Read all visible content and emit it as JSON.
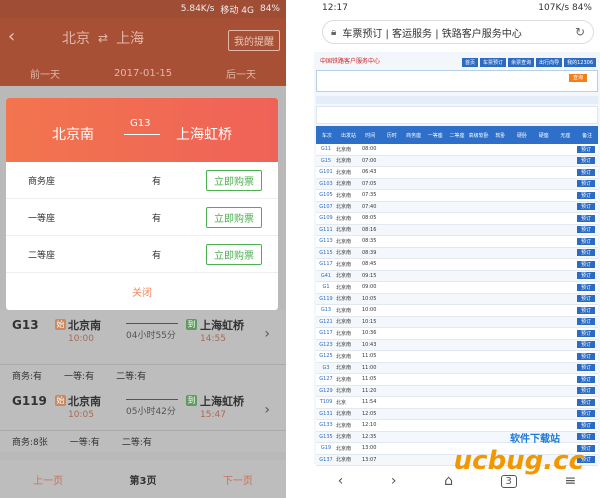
{
  "left": {
    "status": {
      "speed": "5.84K/s",
      "carrier": "移动 4G",
      "battery": "84%"
    },
    "header": {
      "from": "北京",
      "to": "上海",
      "help": "我的提醒"
    },
    "dates": {
      "prev": "前一天",
      "current": "2017-01-15",
      "next": "后一天"
    },
    "modal": {
      "from": "北京南",
      "train": "G13",
      "to": "上海虹桥",
      "seats": [
        {
          "label": "商务座",
          "avail": "有",
          "buy": "立即购票"
        },
        {
          "label": "一等座",
          "avail": "有",
          "buy": "立即购票"
        },
        {
          "label": "二等座",
          "avail": "有",
          "buy": "立即购票"
        }
      ],
      "close": "关闭"
    },
    "trains": [
      {
        "num": "G13",
        "from": "北京南",
        "dep": "10:00",
        "dur": "04小时55分",
        "to": "上海虹桥",
        "arr": "14:55",
        "start_badge": "始",
        "end_badge": "到",
        "seats": [
          "商务:有",
          "一等:有",
          "二等:有"
        ]
      },
      {
        "num": "G119",
        "from": "北京南",
        "dep": "10:05",
        "dur": "05小时42分",
        "to": "上海虹桥",
        "arr": "15:47",
        "start_badge": "始",
        "end_badge": "到",
        "seats": [
          "商务:8张",
          "一等:有",
          "二等:有"
        ]
      }
    ],
    "pager": {
      "prev": "上一页",
      "current": "第3页",
      "next": "下一页"
    }
  },
  "right": {
    "status": {
      "time": "12:17",
      "speed": "107K/s",
      "battery": "84%"
    },
    "address": "车票预订 | 客运服务 | 铁路客户服务中心",
    "logo": "中国铁路客户服务中心",
    "nav": [
      "首页",
      "车票预订",
      "余票查询",
      "出行向导",
      "我的12306"
    ],
    "query": "查询",
    "thead": [
      "车次",
      "出发站",
      "时间",
      "历时",
      "商务座",
      "一等座",
      "二等座",
      "高级软卧",
      "软卧",
      "硬卧",
      "硬座",
      "无座",
      "备注"
    ],
    "rows": [
      {
        "train": "G11",
        "st": "北京南",
        "tm": "08:00"
      },
      {
        "train": "G15",
        "st": "北京南",
        "tm": "07:00"
      },
      {
        "train": "G101",
        "st": "北京南",
        "tm": "06:43"
      },
      {
        "train": "G103",
        "st": "北京南",
        "tm": "07:05"
      },
      {
        "train": "G105",
        "st": "北京南",
        "tm": "07:35"
      },
      {
        "train": "G107",
        "st": "北京南",
        "tm": "07:40"
      },
      {
        "train": "G109",
        "st": "北京南",
        "tm": "08:05"
      },
      {
        "train": "G111",
        "st": "北京南",
        "tm": "08:16"
      },
      {
        "train": "G113",
        "st": "北京南",
        "tm": "08:35"
      },
      {
        "train": "G115",
        "st": "北京南",
        "tm": "08:39"
      },
      {
        "train": "G117",
        "st": "北京南",
        "tm": "08:45"
      },
      {
        "train": "G41",
        "st": "北京南",
        "tm": "09:15"
      },
      {
        "train": "G1",
        "st": "北京南",
        "tm": "09:00"
      },
      {
        "train": "G119",
        "st": "北京南",
        "tm": "10:05"
      },
      {
        "train": "G13",
        "st": "北京南",
        "tm": "10:00"
      },
      {
        "train": "G121",
        "st": "北京南",
        "tm": "10:15"
      },
      {
        "train": "G117",
        "st": "北京南",
        "tm": "10:36"
      },
      {
        "train": "G123",
        "st": "北京南",
        "tm": "10:43"
      },
      {
        "train": "G125",
        "st": "北京南",
        "tm": "11:05"
      },
      {
        "train": "G3",
        "st": "北京南",
        "tm": "11:00"
      },
      {
        "train": "G127",
        "st": "北京南",
        "tm": "11:05"
      },
      {
        "train": "G129",
        "st": "北京南",
        "tm": "11:20"
      },
      {
        "train": "T109",
        "st": "北京",
        "tm": "11:54"
      },
      {
        "train": "G131",
        "st": "北京南",
        "tm": "12:05"
      },
      {
        "train": "G133",
        "st": "北京南",
        "tm": "12:10"
      },
      {
        "train": "G135",
        "st": "北京南",
        "tm": "12:35"
      },
      {
        "train": "G19",
        "st": "北京南",
        "tm": "13:00"
      },
      {
        "train": "G137",
        "st": "北京南",
        "tm": "13:07"
      }
    ],
    "book": "预订",
    "tabs": "3"
  },
  "watermark": {
    "brand": "ucbug.cc",
    "sub": "软件下载站"
  },
  "colors": {
    "accent": "#f2754e",
    "buy_green": "#4caf50",
    "table_blue": "#2d6fc9"
  }
}
